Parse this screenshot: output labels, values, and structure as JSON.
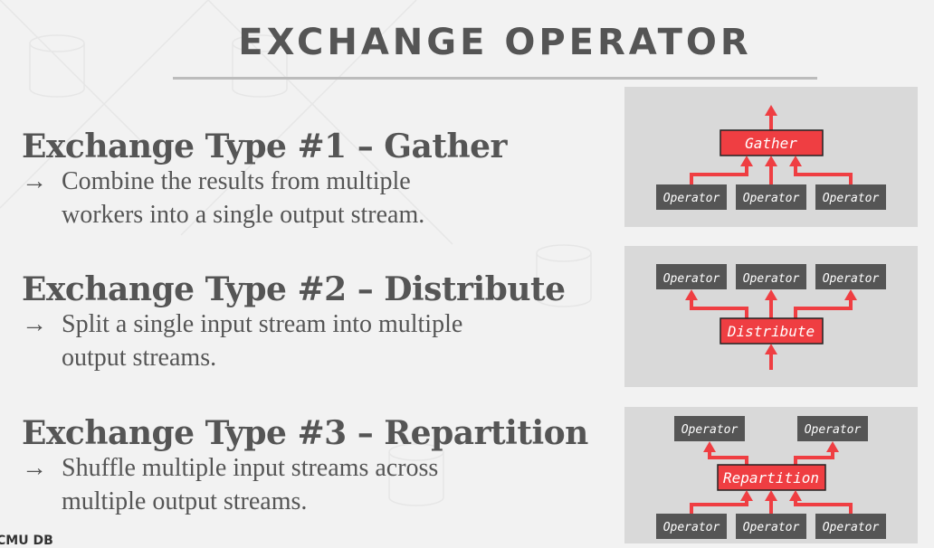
{
  "slide": {
    "title": "EXCHANGE OPERATOR",
    "footer": "CMU DB",
    "accent_color": "#ef3e42",
    "operator_color": "#555555",
    "sections": [
      {
        "heading": "Exchange Type #1 – Gather",
        "bullet_marker": "→",
        "bullet_lines": [
          "Combine the results from multiple",
          "workers into a single output stream."
        ]
      },
      {
        "heading": "Exchange Type #2 – Distribute",
        "bullet_marker": "→",
        "bullet_lines": [
          "Split a single input stream into multiple",
          "output streams."
        ]
      },
      {
        "heading": "Exchange Type #3 – Repartition",
        "bullet_marker": "→",
        "bullet_lines": [
          "Shuffle multiple input streams across",
          "multiple output streams."
        ]
      }
    ],
    "diagrams": {
      "gather": {
        "exchange_label": "Gather",
        "operator_label": "Operator",
        "inputs": 3,
        "outputs": 1
      },
      "distribute": {
        "exchange_label": "Distribute",
        "operator_label": "Operator",
        "inputs": 1,
        "outputs": 3
      },
      "repartition": {
        "exchange_label": "Repartition",
        "operator_label": "Operator",
        "inputs": 3,
        "outputs": 2
      }
    }
  }
}
